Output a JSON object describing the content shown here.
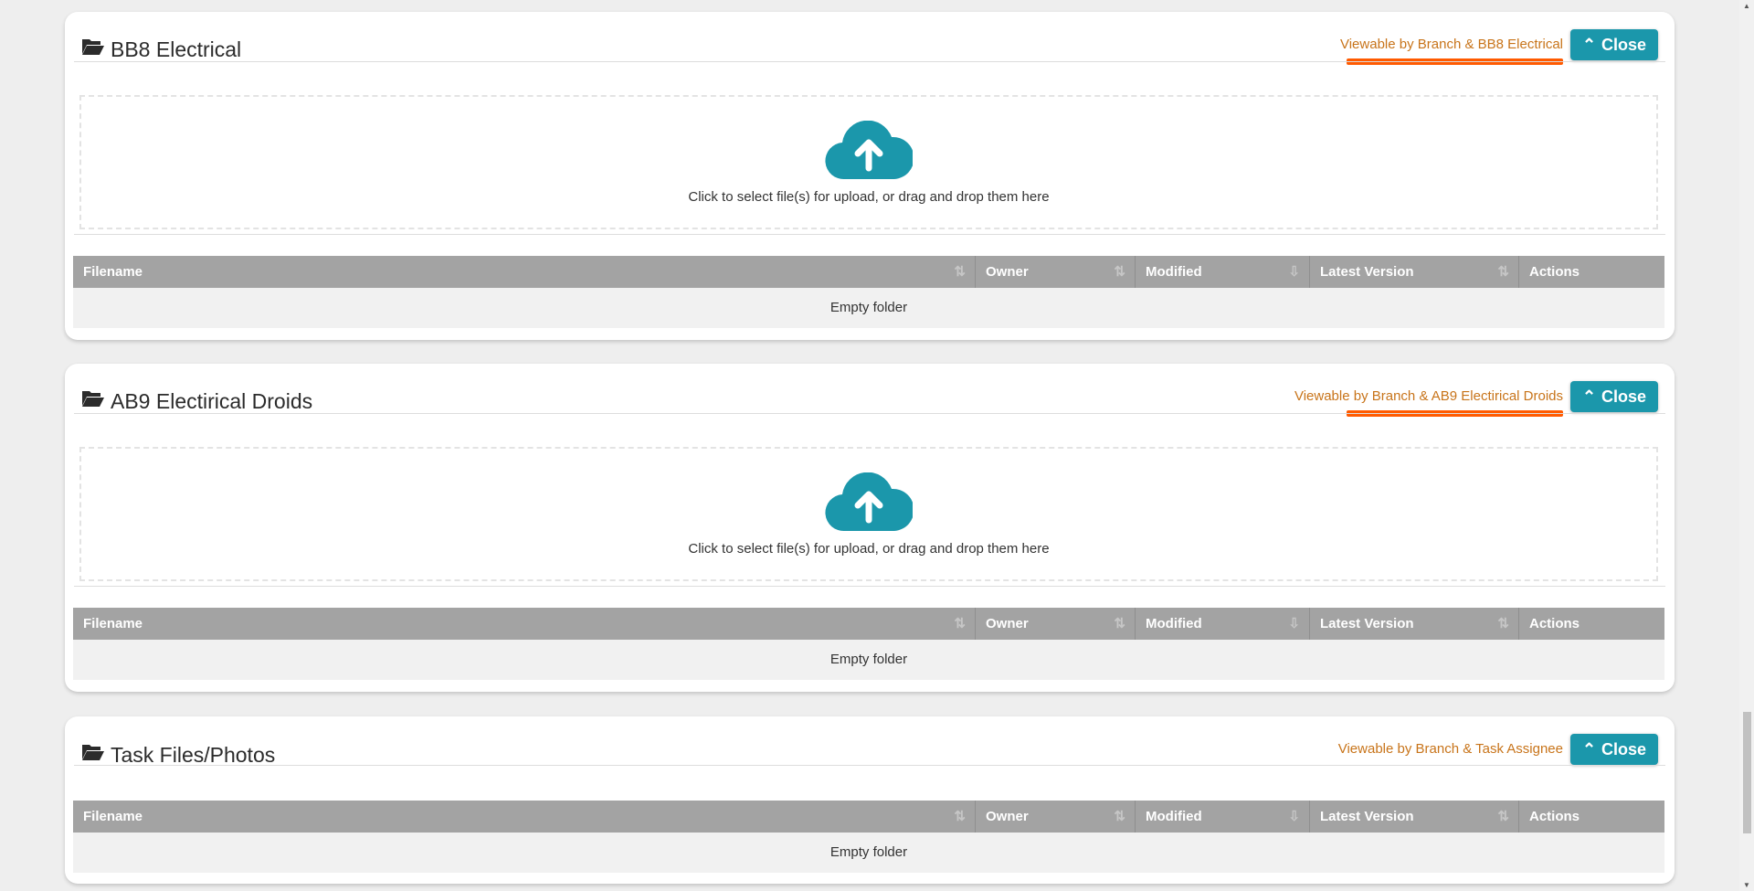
{
  "panels": [
    {
      "title": "BB8 Electrical",
      "visibility": "Viewable by Branch & BB8 Electrical",
      "close_label": "Close",
      "dropzone_text": "Click to select file(s) for upload, or drag and drop them here",
      "empty_text": "Empty folder"
    },
    {
      "title": "AB9 Electirical Droids",
      "visibility": "Viewable by Branch & AB9 Electirical Droids",
      "close_label": "Close",
      "dropzone_text": "Click to select file(s) for upload, or drag and drop them here",
      "empty_text": "Empty folder"
    },
    {
      "title": "Task Files/Photos",
      "visibility": "Viewable by Branch & Task Assignee",
      "close_label": "Close",
      "empty_text": "Empty folder"
    }
  ],
  "columns": [
    "Filename",
    "Owner",
    "Modified",
    "Latest Version",
    "Actions"
  ],
  "colors": {
    "accent": "#1b97ab",
    "visibility_text": "#c8741a",
    "highlight": "#ff5a00",
    "table_header": "#a3a3a3"
  }
}
